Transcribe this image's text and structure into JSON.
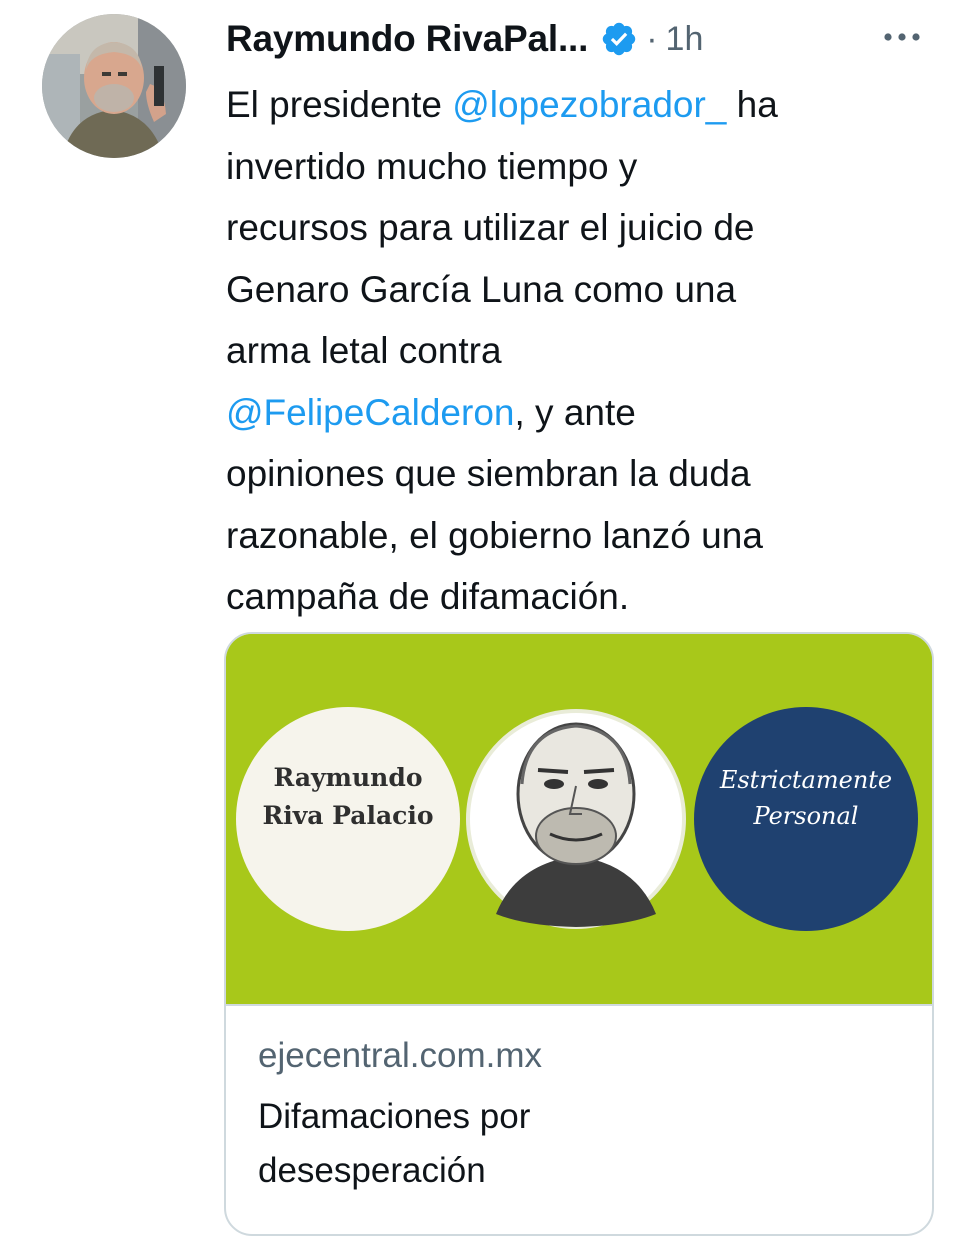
{
  "tweet": {
    "author": {
      "name": "Raymundo RivaPal...",
      "avatar": "author-profile-photo"
    },
    "separator": "·",
    "timestamp": "1h",
    "more_icon": "more-horizontal-icon",
    "verified_icon": "verified-badge-icon",
    "text_lines": [
      [
        {
          "t": "El presidente "
        },
        {
          "t": "@lopezobrador_",
          "mention": true
        },
        {
          "t": " ha"
        }
      ],
      [
        {
          "t": "invertido mucho tiempo y"
        }
      ],
      [
        {
          "t": "recursos para utilizar el juicio de"
        }
      ],
      [
        {
          "t": "Genaro García Luna como una"
        }
      ],
      [
        {
          "t": "arma letal contra"
        }
      ],
      [
        {
          "t": "@FelipeCalderon",
          "mention": true
        },
        {
          "t": ", y ante"
        }
      ],
      [
        {
          "t": "opiniones que siembran la duda"
        }
      ],
      [
        {
          "t": "razonable, el gobierno lanzó una"
        }
      ],
      [
        {
          "t": "campaña de difamación."
        }
      ]
    ]
  },
  "card": {
    "image": {
      "left_circle_text_line1": "Raymundo",
      "left_circle_text_line2": "Riva Palacio",
      "right_circle_text_line1": "Estrictamente",
      "right_circle_text_line2": "Personal",
      "colors": {
        "background": "#a8c81a",
        "left_circle": "#f6f4ec",
        "right_circle": "#1f4170"
      }
    },
    "domain": "ejecentral.com.mx",
    "title_lines": [
      "Difamaciones por",
      "desesperación"
    ]
  },
  "colors": {
    "link": "#1d9bf0",
    "muted": "#536471",
    "text": "#0f1419",
    "border": "#cfd9de",
    "verified": "#1d9bf0"
  }
}
